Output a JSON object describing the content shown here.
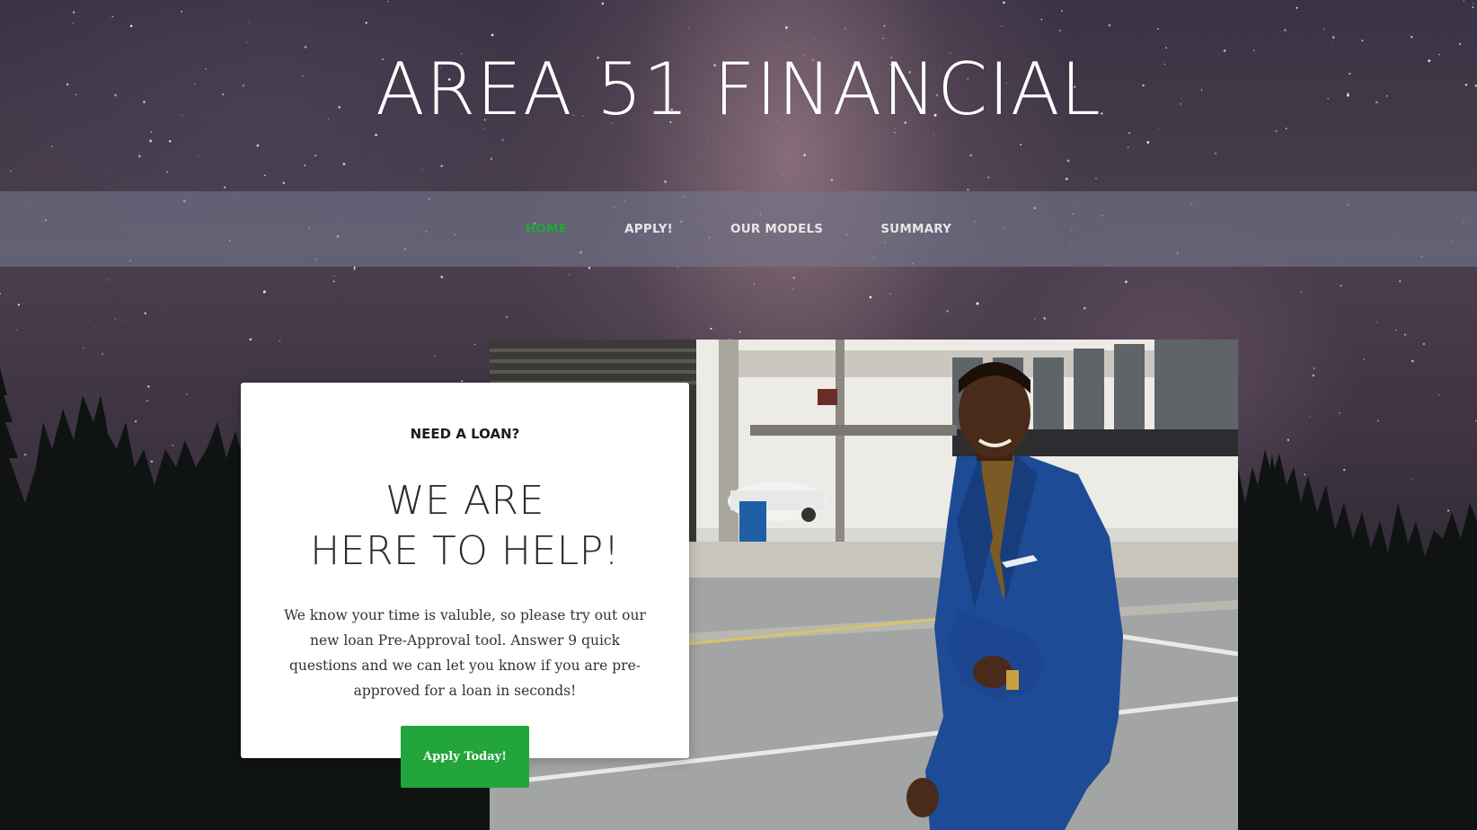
{
  "site": {
    "title": "AREA 51 FINANCIAL"
  },
  "nav": {
    "items": [
      {
        "label": "HOME",
        "active": true
      },
      {
        "label": "APPLY!",
        "active": false
      },
      {
        "label": "OUR MODELS",
        "active": false
      },
      {
        "label": "SUMMARY",
        "active": false
      }
    ]
  },
  "hero": {
    "eyebrow": "NEED A LOAN?",
    "headline_line1": "WE ARE",
    "headline_line2": "HERE TO HELP!",
    "body": "We know your time is valuble, so please try out our new loan Pre-Approval tool. Answer 9 quick questions and we can let you know if you are pre-approved for a loan in seconds!",
    "button_label": "Apply Today!",
    "photo_icon": "businessman-photo"
  },
  "colors": {
    "accent": "#22a53a",
    "nav_bg": "#73768a",
    "card_bg": "#ffffff"
  }
}
